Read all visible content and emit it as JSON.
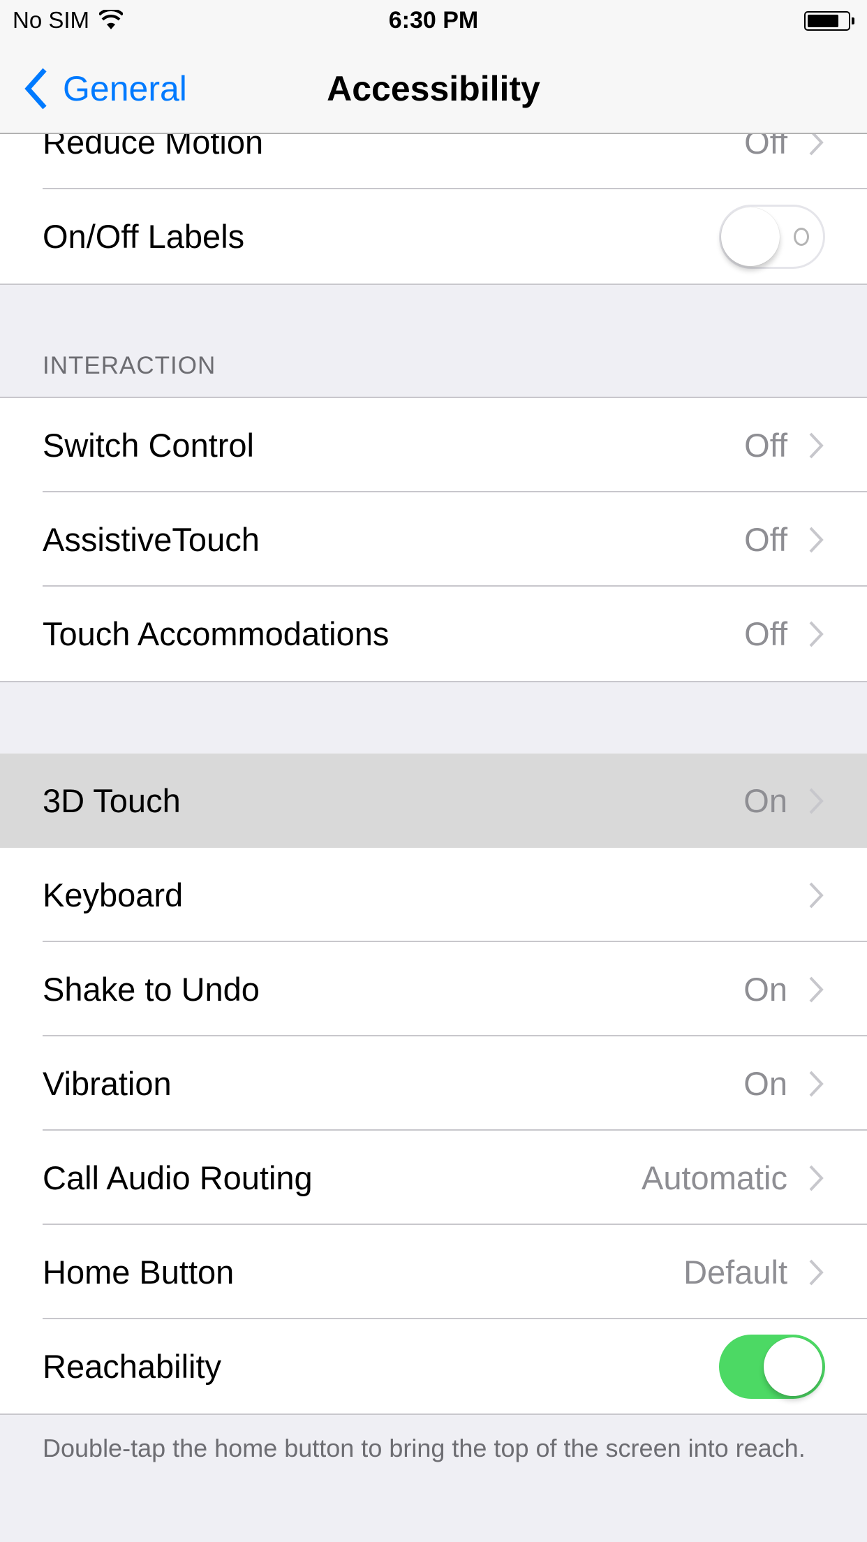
{
  "status_bar": {
    "carrier": "No SIM",
    "time": "6:30 PM",
    "wifi_icon": "wifi-icon",
    "battery_icon": "battery-icon"
  },
  "nav": {
    "back_label": "General",
    "title": "Accessibility"
  },
  "rows_top": [
    {
      "label": "Reduce Motion",
      "value": "Off"
    },
    {
      "label": "On/Off Labels",
      "toggle": false
    }
  ],
  "interaction": {
    "header": "INTERACTION",
    "items": [
      {
        "label": "Switch Control",
        "value": "Off"
      },
      {
        "label": "AssistiveTouch",
        "value": "Off"
      },
      {
        "label": "Touch Accommodations",
        "value": "Off"
      }
    ]
  },
  "group3": {
    "items": [
      {
        "label": "3D Touch",
        "value": "On",
        "highlighted": true
      },
      {
        "label": "Keyboard",
        "value": ""
      },
      {
        "label": "Shake to Undo",
        "value": "On"
      },
      {
        "label": "Vibration",
        "value": "On"
      },
      {
        "label": "Call Audio Routing",
        "value": "Automatic"
      },
      {
        "label": "Home Button",
        "value": "Default"
      },
      {
        "label": "Reachability",
        "toggle": true
      }
    ],
    "footer": "Double-tap the home button to bring the top of the screen into reach."
  },
  "colors": {
    "accent": "#007aff",
    "toggle_on": "#4cd964",
    "secondary_text": "#8e8e93",
    "group_bg": "#efeff4"
  }
}
